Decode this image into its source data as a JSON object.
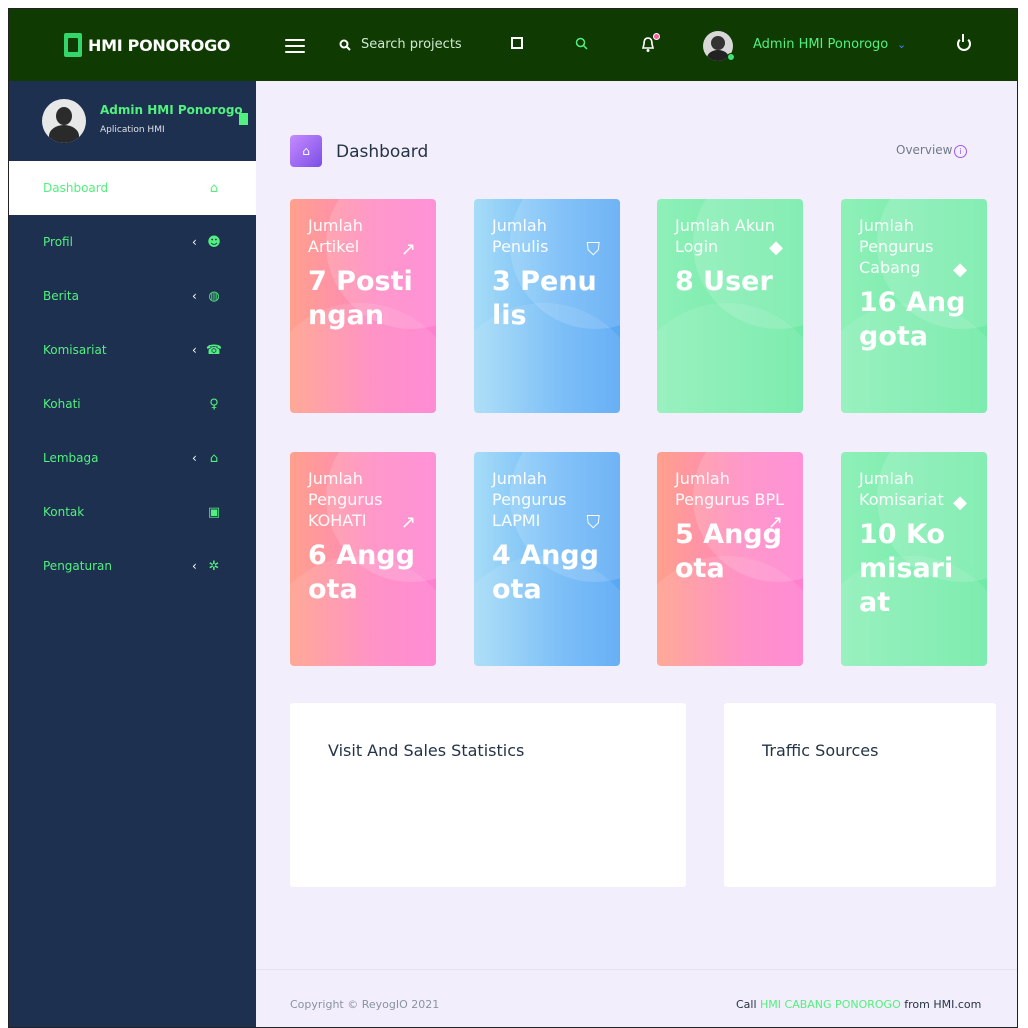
{
  "app": {
    "brand": "HMI PONOROGO"
  },
  "topbar": {
    "search_placeholder": "Search projects",
    "user_name": "Admin HMI Ponorogo",
    "user_chevron": "⌄"
  },
  "sidebar": {
    "profile": {
      "name": "Admin HMI Ponorogo",
      "role": "Aplication HMI"
    },
    "items": [
      {
        "label": "Dashboard",
        "icon": "home-icon",
        "glyph": "⌂",
        "has_chevron": false,
        "active": true
      },
      {
        "label": "Profil",
        "icon": "face-icon",
        "glyph": "☻",
        "has_chevron": true,
        "active": false
      },
      {
        "label": "Berita",
        "icon": "globe-icon",
        "glyph": "◍",
        "has_chevron": true,
        "active": false
      },
      {
        "label": "Komisariat",
        "icon": "users-icon",
        "glyph": "☎",
        "has_chevron": true,
        "active": false
      },
      {
        "label": "Kohati",
        "icon": "female-icon",
        "glyph": "♀",
        "has_chevron": false,
        "active": false
      },
      {
        "label": "Lembaga",
        "icon": "building-icon",
        "glyph": "⌂",
        "has_chevron": true,
        "active": false
      },
      {
        "label": "Kontak",
        "icon": "contact-card-icon",
        "glyph": "▣",
        "has_chevron": false,
        "active": false
      },
      {
        "label": "Pengaturan",
        "icon": "gear-icon",
        "glyph": "✲",
        "has_chevron": true,
        "active": false
      }
    ],
    "chevron": "‹"
  },
  "page": {
    "title": "Dashboard",
    "overview": "Overview",
    "overview_icon": "i"
  },
  "cards": [
    {
      "label": "Jumlah Artikel",
      "value": "7 Postingan",
      "color": "pink",
      "icon": "chart-line-icon",
      "glyph": "↗"
    },
    {
      "label": "Jumlah Penulis",
      "value": "3 Penulis",
      "color": "blue",
      "icon": "bookmark-icon",
      "glyph": "⛉"
    },
    {
      "label": "Jumlah Akun Login",
      "value": "8 User",
      "color": "green",
      "icon": "diamond-icon",
      "glyph": "◆"
    },
    {
      "label": "Jumlah Pengurus Cabang",
      "value": "16 Anggota",
      "color": "green",
      "icon": "diamond-icon",
      "glyph": "◆"
    },
    {
      "label": "Jumlah Pengurus KOHATI",
      "value": "6 Anggota",
      "color": "pink",
      "icon": "chart-line-icon",
      "glyph": "↗"
    },
    {
      "label": "Jumlah Pengurus LAPMI",
      "value": "4 Anggota",
      "color": "blue",
      "icon": "bookmark-icon",
      "glyph": "⛉"
    },
    {
      "label": "Jumlah Pengurus BPL",
      "value": "5 Anggota",
      "color": "pink",
      "icon": "chart-line-icon",
      "glyph": "↗"
    },
    {
      "label": "Jumlah Komisariat",
      "value": "10 Komisariat",
      "color": "green",
      "icon": "diamond-icon",
      "glyph": "◆"
    }
  ],
  "panels": {
    "visit_sales": "Visit And Sales Statistics",
    "traffic": "Traffic Sources"
  },
  "footer": {
    "copyright": "Copyright © ReyogIO 2021",
    "credit_prefix": "Call ",
    "credit_link": "HMI CABANG PONOROGO",
    "credit_suffix": " from HMI.com"
  },
  "colors": {
    "topbar": "#0f3a02",
    "sidebar": "#1d3050",
    "accent_green": "#52f07e",
    "page_bg": "#f3eefb"
  }
}
